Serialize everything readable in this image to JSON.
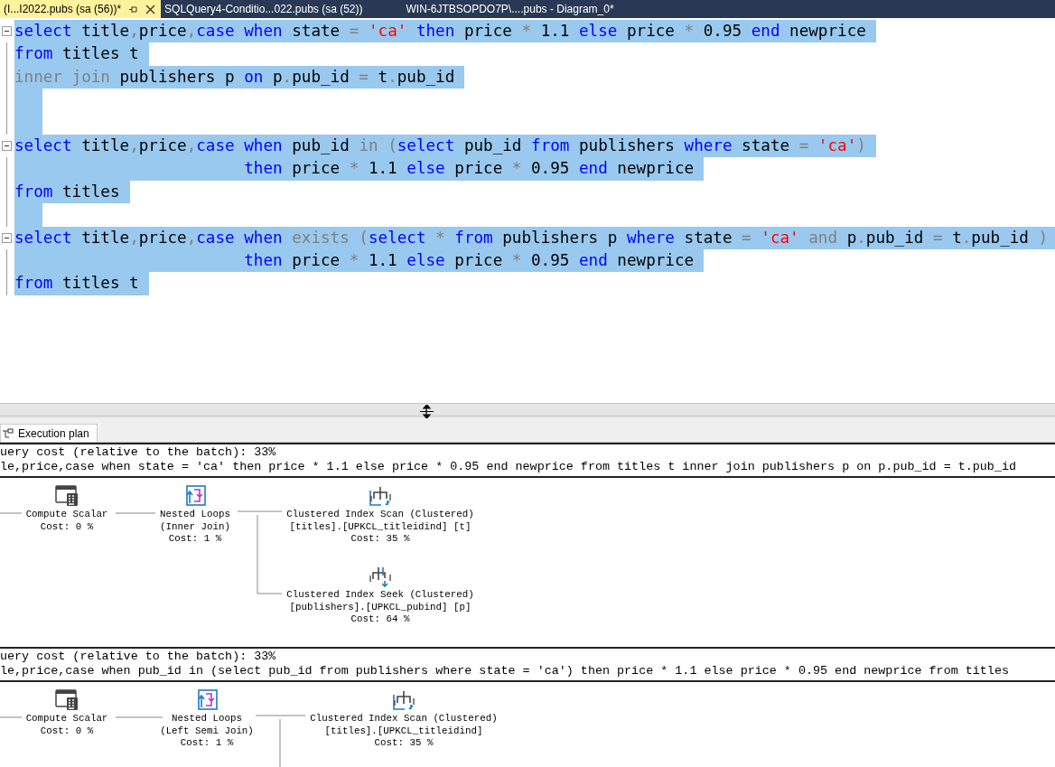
{
  "tabs": [
    {
      "label": "(I...I2022.pubs (sa (56))*",
      "selected": true
    },
    {
      "label": "SQLQuery4-Conditio...022.pubs (sa (52))",
      "selected": false
    },
    {
      "label": "WIN-6JTBSOPDO7P\\....pubs - Diagram_0*",
      "selected": false
    }
  ],
  "editor": {
    "lines": [
      {
        "collapsible": true,
        "selected": true,
        "tokens": [
          {
            "text": "select",
            "kind": "kw"
          },
          {
            "text": " title",
            "kind": "id"
          },
          {
            "text": ",",
            "kind": "op"
          },
          {
            "text": "price",
            "kind": "id"
          },
          {
            "text": ",",
            "kind": "op"
          },
          {
            "text": "case when",
            "kind": "kw"
          },
          {
            "text": " state ",
            "kind": "id"
          },
          {
            "text": "= ",
            "kind": "op"
          },
          {
            "text": "'ca' ",
            "kind": "str"
          },
          {
            "text": "then",
            "kind": "kw"
          },
          {
            "text": " price ",
            "kind": "id"
          },
          {
            "text": "*",
            "kind": "op"
          },
          {
            "text": " 1.1 ",
            "kind": "id"
          },
          {
            "text": "else",
            "kind": "kw"
          },
          {
            "text": " price ",
            "kind": "id"
          },
          {
            "text": "*",
            "kind": "op"
          },
          {
            "text": " 0.95 ",
            "kind": "id"
          },
          {
            "text": "end",
            "kind": "kw"
          },
          {
            "text": " newprice",
            "kind": "id"
          }
        ]
      },
      {
        "collapsible": false,
        "selected": true,
        "tokens": [
          {
            "text": "from",
            "kind": "kw"
          },
          {
            "text": " titles t",
            "kind": "id"
          }
        ]
      },
      {
        "collapsible": false,
        "selected": true,
        "tokens": [
          {
            "text": "inner join",
            "kind": "op"
          },
          {
            "text": " publishers p ",
            "kind": "id"
          },
          {
            "text": "on",
            "kind": "kw"
          },
          {
            "text": " p",
            "kind": "id"
          },
          {
            "text": ".",
            "kind": "op"
          },
          {
            "text": "pub_id ",
            "kind": "id"
          },
          {
            "text": "=",
            "kind": "op"
          },
          {
            "text": " t",
            "kind": "id"
          },
          {
            "text": ".",
            "kind": "op"
          },
          {
            "text": "pub_id",
            "kind": "id"
          }
        ]
      },
      {
        "collapsible": false,
        "selected": true
      },
      {
        "collapsible": false,
        "selected": true
      },
      {
        "collapsible": true,
        "selected": true,
        "tokens": [
          {
            "text": "select",
            "kind": "kw"
          },
          {
            "text": " title",
            "kind": "id"
          },
          {
            "text": ",",
            "kind": "op"
          },
          {
            "text": "price",
            "kind": "id"
          },
          {
            "text": ",",
            "kind": "op"
          },
          {
            "text": "case when",
            "kind": "kw"
          },
          {
            "text": " pub_id ",
            "kind": "id"
          },
          {
            "text": "in (",
            "kind": "op"
          },
          {
            "text": "select",
            "kind": "kw"
          },
          {
            "text": " pub_id ",
            "kind": "id"
          },
          {
            "text": "from",
            "kind": "kw"
          },
          {
            "text": " publishers ",
            "kind": "id"
          },
          {
            "text": "where",
            "kind": "kw"
          },
          {
            "text": " state ",
            "kind": "id"
          },
          {
            "text": "= ",
            "kind": "op"
          },
          {
            "text": "'ca'",
            "kind": "str"
          },
          {
            "text": ")",
            "kind": "op"
          }
        ]
      },
      {
        "collapsible": false,
        "selected": true,
        "tokens": [
          {
            "text": "                        then",
            "kind": "kw"
          },
          {
            "text": " price ",
            "kind": "id"
          },
          {
            "text": "*",
            "kind": "op"
          },
          {
            "text": " 1.1 ",
            "kind": "id"
          },
          {
            "text": "else",
            "kind": "kw"
          },
          {
            "text": " price ",
            "kind": "id"
          },
          {
            "text": "*",
            "kind": "op"
          },
          {
            "text": " 0.95 ",
            "kind": "id"
          },
          {
            "text": "end",
            "kind": "kw"
          },
          {
            "text": " newprice",
            "kind": "id"
          }
        ]
      },
      {
        "collapsible": false,
        "selected": true,
        "tokens": [
          {
            "text": "from",
            "kind": "kw"
          },
          {
            "text": " titles",
            "kind": "id"
          }
        ]
      },
      {
        "collapsible": false,
        "selected": true
      },
      {
        "collapsible": true,
        "selected": true,
        "tokens": [
          {
            "text": "select",
            "kind": "kw"
          },
          {
            "text": " title",
            "kind": "id"
          },
          {
            "text": ",",
            "kind": "op"
          },
          {
            "text": "price",
            "kind": "id"
          },
          {
            "text": ",",
            "kind": "op"
          },
          {
            "text": "case when",
            "kind": "kw"
          },
          {
            "text": " exists (",
            "kind": "op"
          },
          {
            "text": "select",
            "kind": "kw"
          },
          {
            "text": " * ",
            "kind": "op"
          },
          {
            "text": "from",
            "kind": "kw"
          },
          {
            "text": " publishers p ",
            "kind": "id"
          },
          {
            "text": "where",
            "kind": "kw"
          },
          {
            "text": " state ",
            "kind": "id"
          },
          {
            "text": "= ",
            "kind": "op"
          },
          {
            "text": "'ca'",
            "kind": "str"
          },
          {
            "text": " and ",
            "kind": "op"
          },
          {
            "text": "p",
            "kind": "id"
          },
          {
            "text": ".",
            "kind": "op"
          },
          {
            "text": "pub_id ",
            "kind": "id"
          },
          {
            "text": "=",
            "kind": "op"
          },
          {
            "text": " t",
            "kind": "id"
          },
          {
            "text": ".",
            "kind": "op"
          },
          {
            "text": "pub_id ",
            "kind": "id"
          },
          {
            "text": ")",
            "kind": "op"
          }
        ]
      },
      {
        "collapsible": false,
        "selected": true,
        "tokens": [
          {
            "text": "                        then",
            "kind": "kw"
          },
          {
            "text": " price ",
            "kind": "id"
          },
          {
            "text": "*",
            "kind": "op"
          },
          {
            "text": " 1.1 ",
            "kind": "id"
          },
          {
            "text": "else",
            "kind": "kw"
          },
          {
            "text": " price ",
            "kind": "id"
          },
          {
            "text": "*",
            "kind": "op"
          },
          {
            "text": " 0.95 ",
            "kind": "id"
          },
          {
            "text": "end",
            "kind": "kw"
          },
          {
            "text": " newprice",
            "kind": "id"
          }
        ]
      },
      {
        "collapsible": false,
        "selected": true,
        "tokens": [
          {
            "text": "from",
            "kind": "kw"
          },
          {
            "text": " titles t",
            "kind": "id"
          }
        ]
      }
    ]
  },
  "results": {
    "tabs": [
      {
        "label": "Execution plan",
        "selected": true
      }
    ],
    "queries": [
      {
        "cost": "uery cost (relative to the batch): 33%",
        "sql": "le,price,case when state = 'ca' then price * 1.1 else price * 0.95 end newprice from titles t inner join publishers p on p.pub_id = t.pub_id",
        "nodes": [
          {
            "kind": "compute",
            "lines": [
              "Compute Scalar",
              "Cost: 0 %"
            ]
          },
          {
            "kind": "nested",
            "lines": [
              "Nested Loops",
              "(Inner Join)",
              "Cost: 1 %"
            ]
          },
          {
            "kind": "scan",
            "lines": [
              "Clustered Index Scan (Clustered)",
              "[titles].[UPKCL_titleidind] [t]",
              "Cost: 35 %"
            ]
          },
          {
            "kind": "seek",
            "lines": [
              "Clustered Index Seek (Clustered)",
              "[publishers].[UPKCL_pubind] [p]",
              "Cost: 64 %"
            ]
          }
        ]
      },
      {
        "cost": "uery cost (relative to the batch): 33%",
        "sql": "le,price,case when pub_id in (select pub_id from publishers where state = 'ca') then price * 1.1 else price * 0.95 end newprice from titles",
        "nodes": [
          {
            "kind": "compute",
            "lines": [
              "Compute Scalar",
              "Cost: 0 %"
            ]
          },
          {
            "kind": "nested",
            "lines": [
              "Nested Loops",
              "(Left Semi Join)",
              "Cost: 1 %"
            ]
          },
          {
            "kind": "scan",
            "lines": [
              "Clustered Index Scan (Clustered)",
              "[titles].[UPKCL_titleidind]",
              "Cost: 35 %"
            ]
          }
        ]
      }
    ]
  }
}
